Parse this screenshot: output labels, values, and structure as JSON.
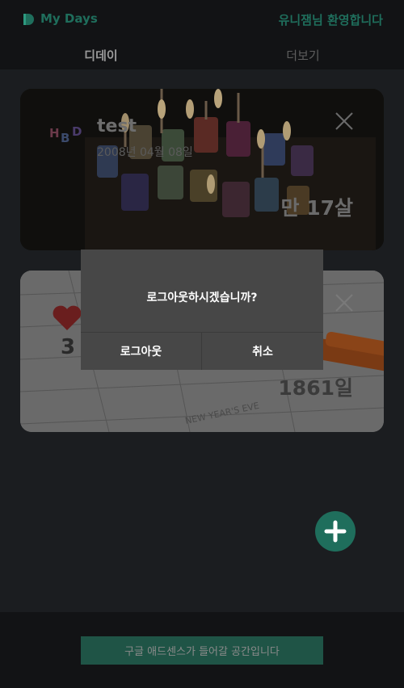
{
  "header": {
    "app_title": "My Days",
    "welcome": "유니잼님 환영합니다"
  },
  "tabs": [
    {
      "label": "디데이",
      "active": true
    },
    {
      "label": "더보기",
      "active": false
    }
  ],
  "cards": [
    {
      "title": "test",
      "date": "2008년 04월 08일",
      "count": "만 17살",
      "icon": "hbd-icon"
    },
    {
      "partial_number": "3",
      "count": "1861일",
      "icon": "heart-icon"
    }
  ],
  "dialog": {
    "message": "로그아웃하시겠습니까?",
    "confirm_label": "로그아웃",
    "cancel_label": "취소"
  },
  "fab": {
    "icon": "plus-icon"
  },
  "footer": {
    "ad_text": "구글 애드센스가 들어갈 공간입니다"
  },
  "colors": {
    "accent": "#1f6e5c",
    "background": "#1b1d20",
    "dialog": "#474747"
  }
}
